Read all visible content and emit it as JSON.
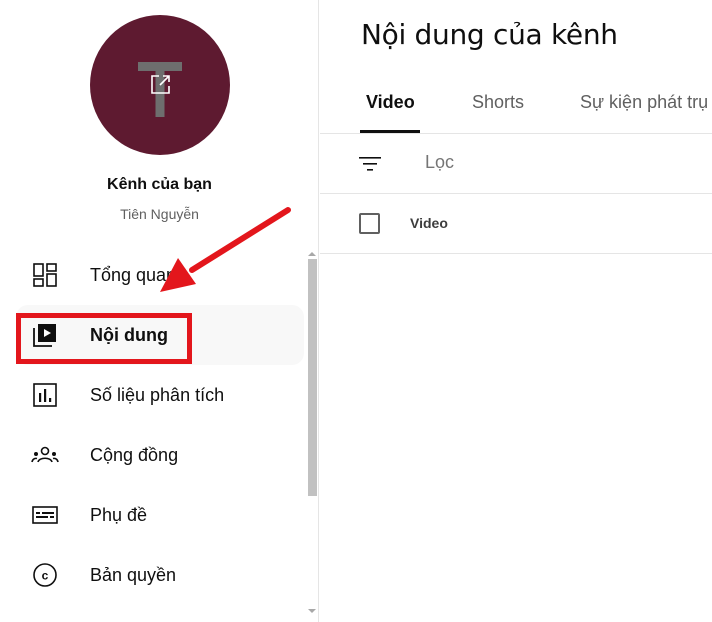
{
  "sidebar": {
    "avatar": {
      "letter": "T",
      "background": "#5e1a30",
      "edit_icon": "external-edit-icon"
    },
    "channel_title": "Kênh của bạn",
    "channel_user": "Tiên Nguyễn",
    "items": [
      {
        "label": "Tổng quan",
        "icon": "dashboard-icon",
        "active": false
      },
      {
        "label": "Nội dung",
        "icon": "content-icon",
        "active": true
      },
      {
        "label": "Số liệu phân tích",
        "icon": "analytics-icon",
        "active": false
      },
      {
        "label": "Cộng đồng",
        "icon": "community-icon",
        "active": false
      },
      {
        "label": "Phụ đề",
        "icon": "subtitles-icon",
        "active": false
      },
      {
        "label": "Bản quyền",
        "icon": "copyright-icon",
        "active": false
      }
    ]
  },
  "main": {
    "title": "Nội dung của kênh",
    "tabs": [
      {
        "label": "Video",
        "active": true
      },
      {
        "label": "Shorts",
        "active": false
      },
      {
        "label": "Sự kiện phát trụ",
        "active": false
      }
    ],
    "filter": {
      "placeholder": "Lọc",
      "icon": "filter-icon"
    },
    "table": {
      "columns": [
        "Video"
      ]
    }
  },
  "annotation": {
    "color": "#e3161c",
    "target": "Nội dung"
  }
}
